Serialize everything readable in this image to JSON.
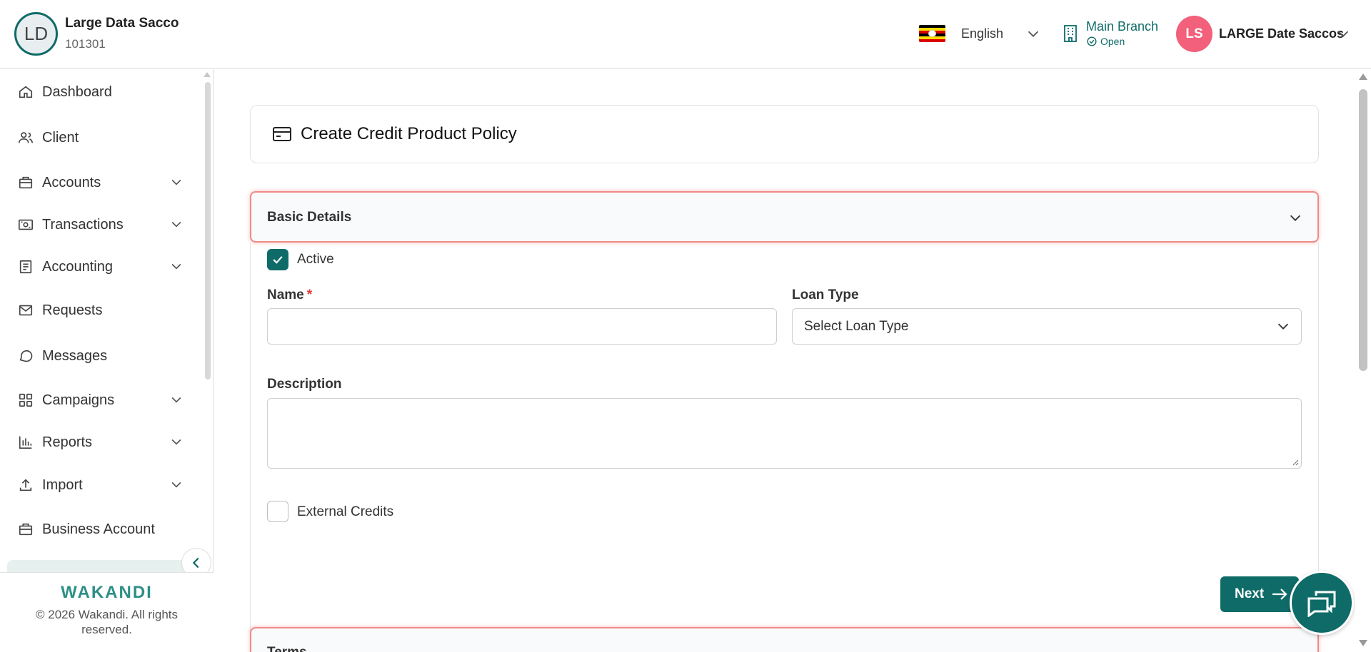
{
  "header": {
    "org_initials": "LD",
    "org_name": "Large Data Sacco",
    "org_code": "101301",
    "language": "English",
    "branch_name": "Main Branch",
    "branch_status": "Open",
    "user_initials": "LS",
    "user_name": "LARGE Date Saccos"
  },
  "sidebar": {
    "items": [
      {
        "label": "Dashboard",
        "icon": "home-icon",
        "expandable": false
      },
      {
        "label": "Client",
        "icon": "users-icon",
        "expandable": false
      },
      {
        "label": "Accounts",
        "icon": "briefcase-icon",
        "expandable": true
      },
      {
        "label": "Transactions",
        "icon": "cash-icon",
        "expandable": true
      },
      {
        "label": "Accounting",
        "icon": "ledger-icon",
        "expandable": true
      },
      {
        "label": "Requests",
        "icon": "mail-icon",
        "expandable": false
      },
      {
        "label": "Messages",
        "icon": "chat-icon",
        "expandable": false
      },
      {
        "label": "Campaigns",
        "icon": "grid-icon",
        "expandable": true
      },
      {
        "label": "Reports",
        "icon": "bar-chart-icon",
        "expandable": true
      },
      {
        "label": "Import",
        "icon": "upload-icon",
        "expandable": true
      },
      {
        "label": "Business Account",
        "icon": "briefcase-icon",
        "expandable": false
      }
    ],
    "brand": "WAKANDI",
    "copyright": "© 2026 Wakandi. All rights reserved."
  },
  "main": {
    "page_title": "Create Credit Product Policy",
    "section_basic": "Basic Details",
    "active_label": "Active",
    "active_checked": true,
    "name_label": "Name",
    "name_required": "*",
    "name_value": "",
    "loan_type_label": "Loan Type",
    "loan_type_placeholder": "Select Loan Type",
    "description_label": "Description",
    "description_value": "",
    "external_credits_label": "External Credits",
    "external_credits_checked": false,
    "next_label": "Next",
    "section_terms": "Terms"
  },
  "colors": {
    "brand": "#0f6b68",
    "avatar": "#f2607b",
    "section_border": "#f08a8a"
  }
}
